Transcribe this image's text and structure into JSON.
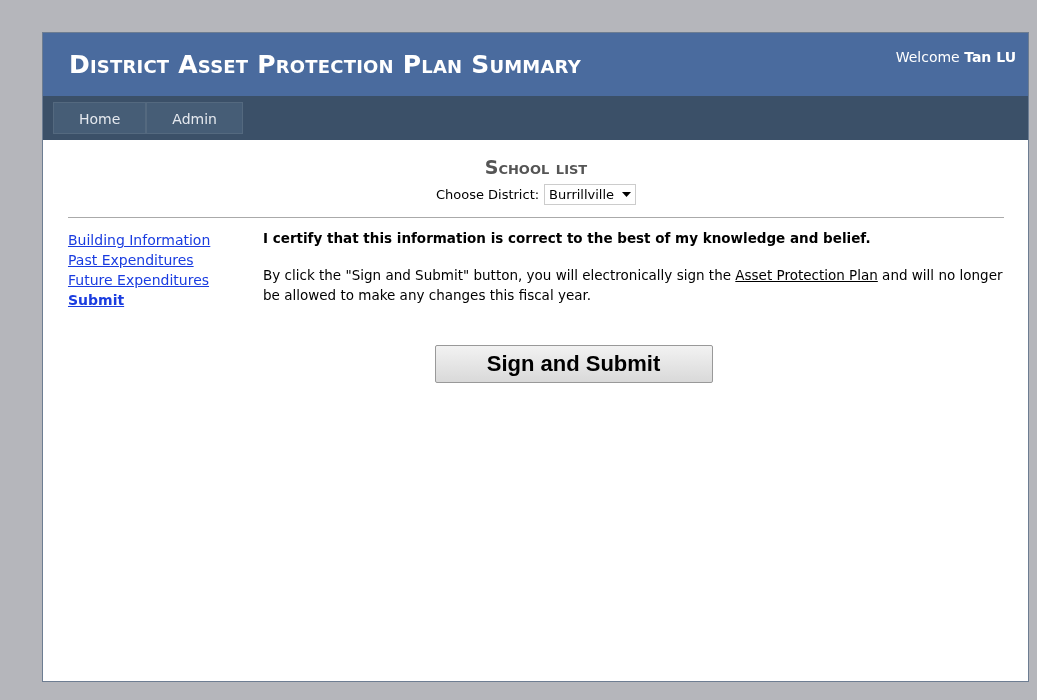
{
  "header": {
    "title": "District Asset Protection Plan Summary",
    "welcome": "Welcome",
    "user": "Tan LU"
  },
  "nav": [
    {
      "label": "Home"
    },
    {
      "label": "Admin"
    }
  ],
  "school_list": {
    "title": "School list",
    "district_label": "Choose District:",
    "district_value": "Burrillville"
  },
  "sidebar": {
    "items": [
      {
        "label": "Building Information",
        "selected": false
      },
      {
        "label": "Past Expenditures",
        "selected": false
      },
      {
        "label": "Future Expenditures",
        "selected": false
      },
      {
        "label": "Submit",
        "selected": true
      }
    ]
  },
  "content": {
    "certify": "I certify that this information is correct to the best of my knowledge and belief.",
    "notice_before": "By click the \"Sign and Submit\" button, you will electronically sign the",
    "notice_link": "Asset Protection Plan",
    "notice_after": "and will no longer be allowed to make any changes this fiscal year.",
    "button": "Sign and Submit"
  }
}
